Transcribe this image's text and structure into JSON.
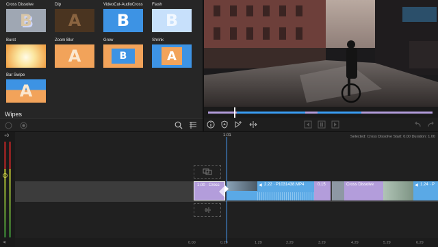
{
  "browser": {
    "tiles": [
      {
        "label": "Cross Dissolve",
        "glyph": "B"
      },
      {
        "label": "Dip",
        "glyph": "A"
      },
      {
        "label": "VideoCut-AudioCross",
        "glyph": "B"
      },
      {
        "label": "Flash",
        "glyph": "B"
      },
      {
        "label": "Burst",
        "glyph": ""
      },
      {
        "label": "Zoom Blur",
        "glyph": "A"
      },
      {
        "label": "Grow",
        "glyph": "B"
      },
      {
        "label": "Shrink",
        "glyph": "A"
      },
      {
        "label": "Bar Swipe",
        "glyph": "A"
      }
    ],
    "section_label": "Wipes"
  },
  "timeline": {
    "playhead_time": "1.01",
    "status": "Selected: Cross Dissolve Start: 0.00 Duration: 1.00",
    "level_label": "+0",
    "ticks": [
      "0.00",
      "0.29",
      "1.29",
      "2.29",
      "3.29",
      "4.29",
      "5.29",
      "6.29"
    ],
    "clips": [
      {
        "label": "1.00 · Cross",
        "kind": "transition"
      },
      {
        "label": "",
        "kind": "video-thumb"
      },
      {
        "label": "2.22 · P1031438.MP4",
        "kind": "video"
      },
      {
        "label": "0.15",
        "kind": "video"
      },
      {
        "label": "Cross Dissolve",
        "kind": "transition"
      },
      {
        "label": "1.24 · P",
        "kind": "video"
      }
    ]
  },
  "colors": {
    "accent": "#3a9ff5",
    "transition": "#b39ddb",
    "clip_blue": "#5aa9e6"
  }
}
